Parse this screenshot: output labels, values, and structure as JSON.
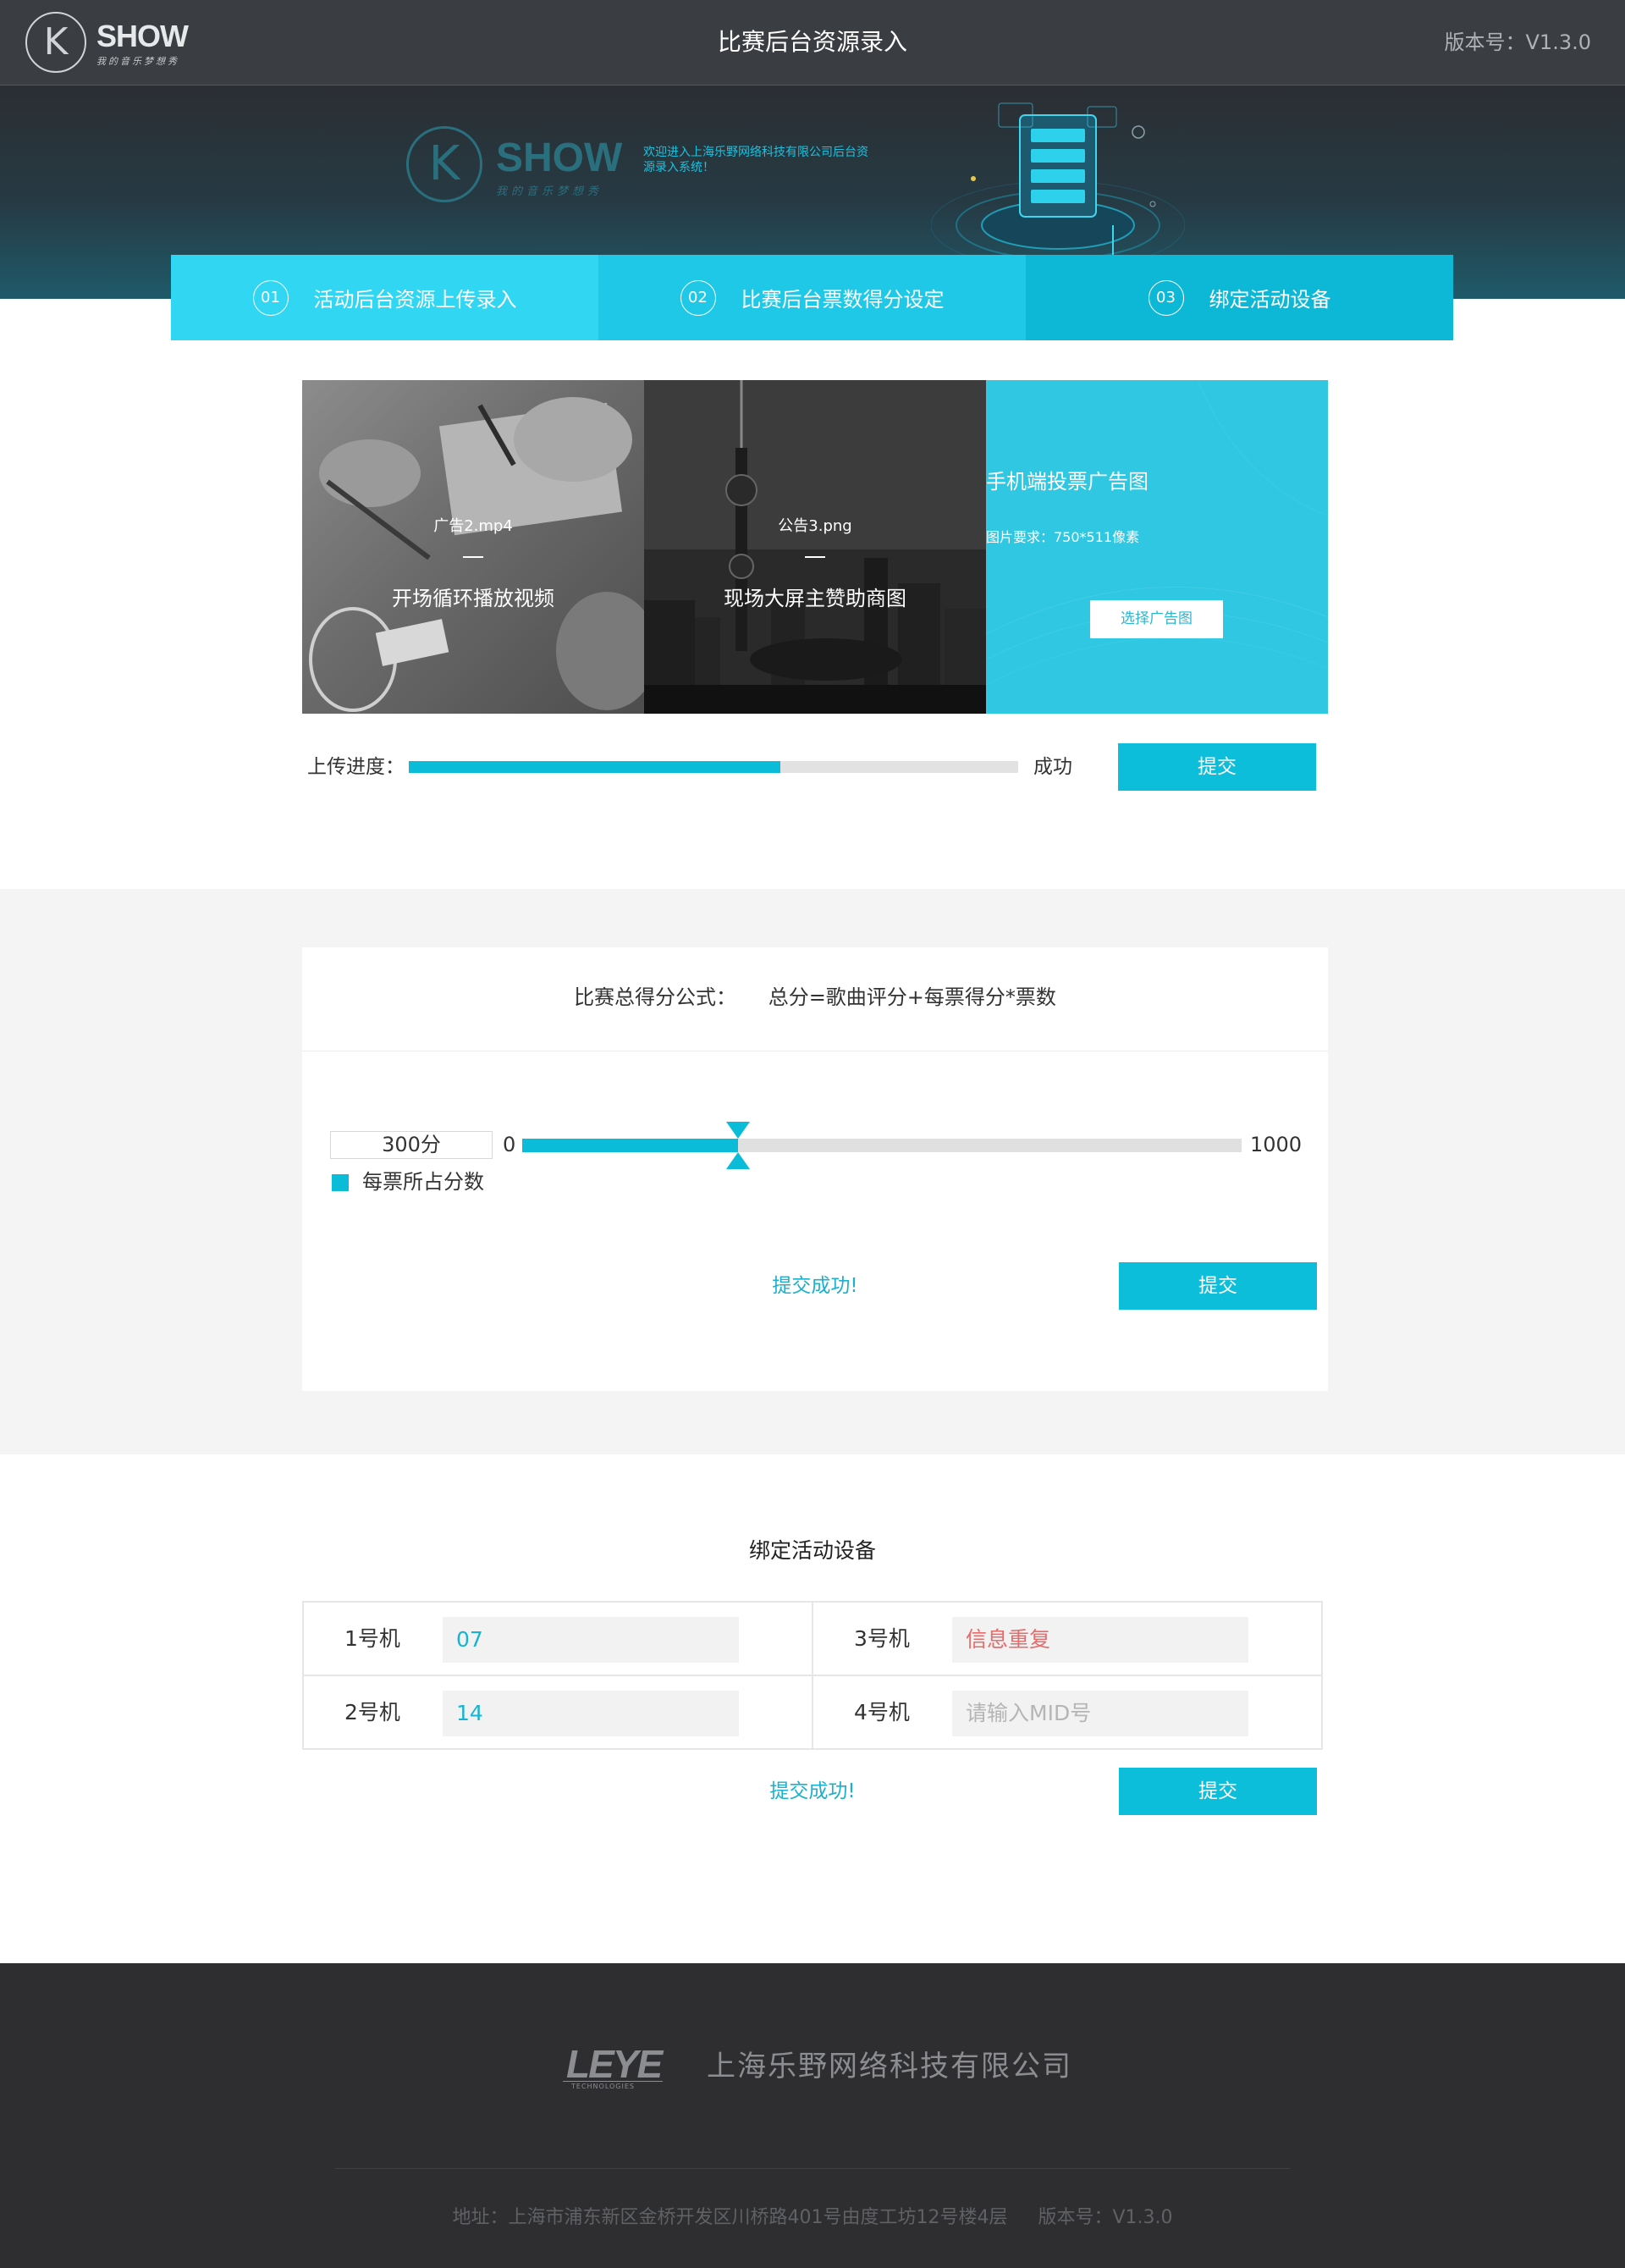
{
  "header": {
    "logo_word": "SHOW",
    "logo_tagline": "我的音乐梦想秀",
    "title": "比赛后台资源录入",
    "version": "版本号：V1.3.0"
  },
  "banner": {
    "logo_word": "SHOW",
    "logo_tagline": "我的音乐梦想秀",
    "welcome": "欢迎进入上海乐野网络科技有限公司后台资源录入系统！"
  },
  "tabs": [
    {
      "num": "01",
      "label": "活动后台资源上传录入"
    },
    {
      "num": "02",
      "label": "比赛后台票数得分设定"
    },
    {
      "num": "03",
      "label": "绑定活动设备"
    }
  ],
  "media": {
    "video": {
      "filename": "广告2.mp4",
      "caption": "开场循环播放视频"
    },
    "image": {
      "filename": "公告3.png",
      "caption": "现场大屏主赞助商图"
    },
    "mobile_ad": {
      "title": "手机端投票广告图",
      "requirement": "图片要求：750*511像素",
      "button": "选择广告图"
    }
  },
  "upload": {
    "label": "上传进度：",
    "progress": 0.61,
    "status": "成功",
    "submit": "提交"
  },
  "score": {
    "formula_label": "比赛总得分公式：",
    "formula": "总分=歌曲评分+每票得分*票数",
    "value_display": "300分",
    "value": 300,
    "min": "0",
    "max": "1000",
    "min_value": 0,
    "max_value": 1000,
    "legend": "每票所占分数",
    "success": "提交成功!",
    "submit": "提交"
  },
  "binding": {
    "title": "绑定活动设备",
    "devices": [
      {
        "label": "1号机",
        "value": "07",
        "state": "ok"
      },
      {
        "label": "3号机",
        "value": "信息重复",
        "state": "error"
      },
      {
        "label": "2号机",
        "value": "14",
        "state": "ok"
      },
      {
        "label": "4号机",
        "value": "",
        "placeholder": "请输入MID号",
        "state": "empty"
      }
    ],
    "success": "提交成功!",
    "submit": "提交"
  },
  "footer": {
    "logo_word": "LEYE",
    "logo_sub": "TECHNOLOGIES",
    "company": "上海乐野网络科技有限公司",
    "address": "地址：上海市浦东新区金桥开发区川桥路401号由度工坊12号楼4层",
    "version": "版本号：V1.3.0"
  },
  "colors": {
    "accent": "#0dbedb",
    "error": "#e86a6a",
    "topbar": "#3a3d42",
    "footer": "#2e2e30"
  }
}
